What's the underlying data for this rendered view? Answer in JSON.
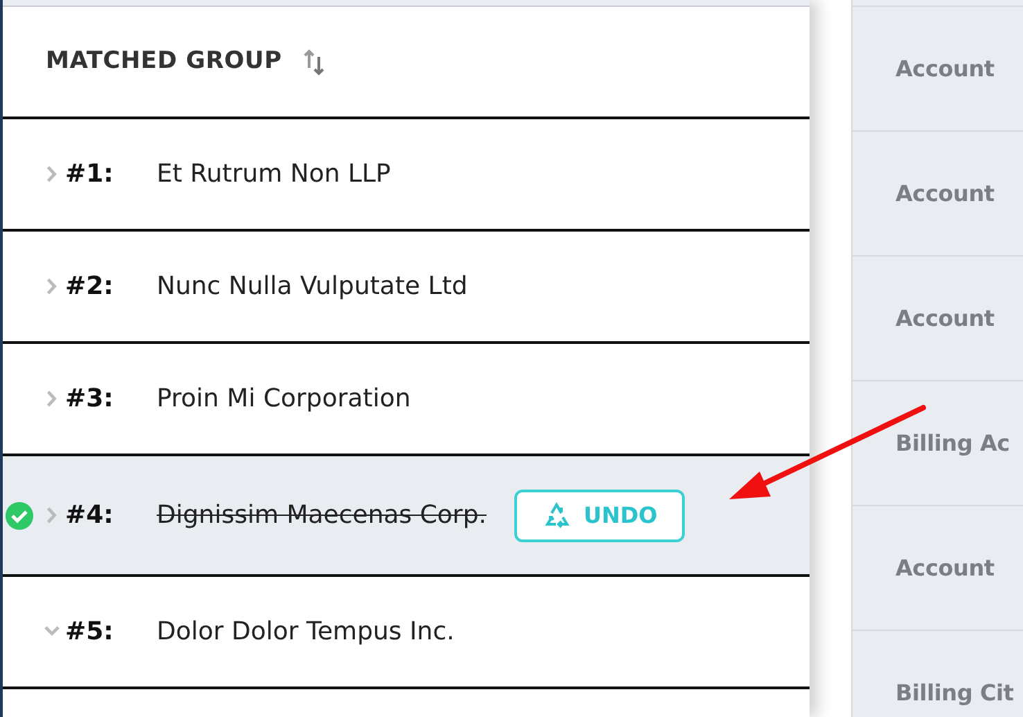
{
  "table": {
    "header": "MATCHED GROUP",
    "rows": [
      {
        "number": "#1:",
        "name": "Et Rutrum Non LLP",
        "expanded": false,
        "resolved": false
      },
      {
        "number": "#2:",
        "name": "Nunc Nulla Vulputate Ltd",
        "expanded": false,
        "resolved": false
      },
      {
        "number": "#3:",
        "name": "Proin Mi Corporation",
        "expanded": false,
        "resolved": false
      },
      {
        "number": "#4:",
        "name": "Dignissim Maecenas Corp.",
        "expanded": false,
        "resolved": true,
        "action": "UNDO"
      },
      {
        "number": "#5:",
        "name": "Dolor Dolor Tempus Inc.",
        "expanded": true,
        "resolved": false
      }
    ]
  },
  "side_panel": {
    "fields": [
      "Account",
      "Account",
      "Account",
      "Billing Ac",
      "Account",
      "Billing Cit"
    ]
  }
}
